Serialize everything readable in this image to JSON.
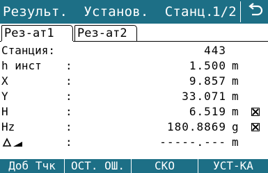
{
  "header": {
    "title": "Результ.  Установ.  Станц.",
    "page": "1/2"
  },
  "tabs": [
    {
      "label": "Рез-ат1"
    },
    {
      "label": "Рез-ат2"
    }
  ],
  "rows": [
    {
      "label": "Станция:",
      "value": "443",
      "unit": "",
      "checkbox": false
    },
    {
      "label": "h инст",
      "value": "1.500",
      "unit": "m",
      "checkbox": false
    },
    {
      "label": "X",
      "value": "9.857",
      "unit": "m",
      "checkbox": false
    },
    {
      "label": "Y",
      "value": "33.071",
      "unit": "m",
      "checkbox": false
    },
    {
      "label": "H",
      "value": "6.519",
      "unit": "m",
      "checkbox": true
    },
    {
      "label": "Hz",
      "value": "180.8869",
      "unit": "g",
      "checkbox": true
    },
    {
      "label": "",
      "value": "-----.---",
      "unit": "m",
      "checkbox": false
    }
  ],
  "softkeys": [
    {
      "label": "Доб Тчк"
    },
    {
      "label": "ОСТ. ОШ."
    },
    {
      "label": "СКО"
    },
    {
      "label": "УСТ-КА"
    }
  ],
  "icons": {
    "back": "back-arrow-icon",
    "checkbox": "checkbox-cross-icon",
    "delta": "delta-height-icon"
  },
  "colors": {
    "bar": "#1d6f86",
    "text": "#000000",
    "bar_text": "#ffffff"
  }
}
